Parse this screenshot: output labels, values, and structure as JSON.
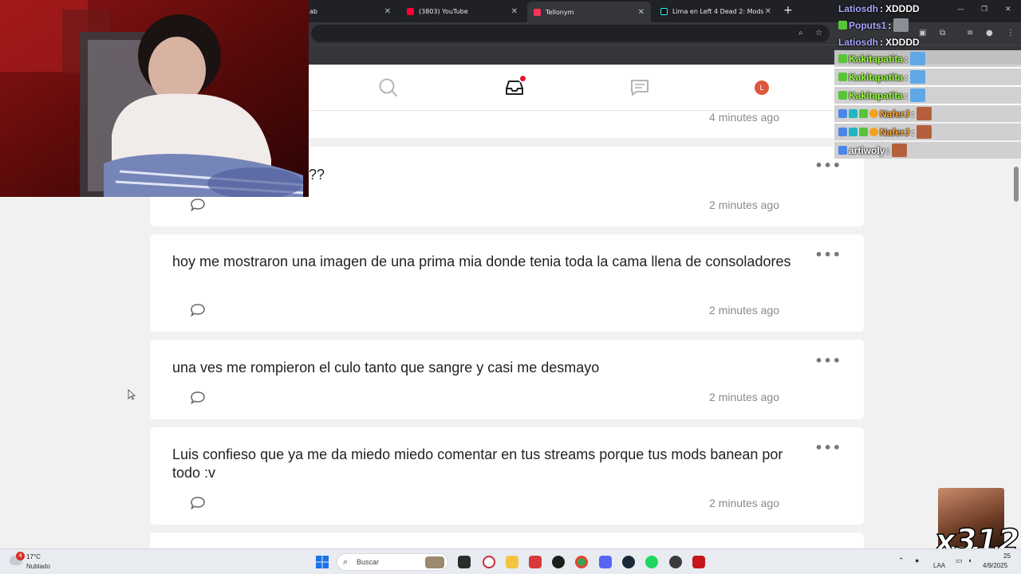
{
  "browser": {
    "tabs": [
      {
        "title": "ab",
        "icon": "tab-favicon"
      },
      {
        "title": "(3803) YouTube",
        "icon": "youtube-icon",
        "color": "#ff0033"
      },
      {
        "title": "Tellonym",
        "icon": "tellonym-icon",
        "color": "#f6335a"
      },
      {
        "title": "Lima en Left 4 Dead 2: Mods y",
        "icon": "tiktok-icon"
      }
    ],
    "new_tab": "+"
  },
  "app": {
    "accent": "#e0182e",
    "avatar_initial": "L",
    "nav": [
      "search-icon",
      "inbox-icon",
      "chat-icon",
      "profile-avatar"
    ]
  },
  "feed": {
    "partial_top_time": "4 minutes ago",
    "cards": [
      {
        "text": "??",
        "time": "2 minutes ago"
      },
      {
        "text": "hoy me mostraron una imagen de una prima mia donde tenia toda la cama llena de consoladores",
        "time": "2 minutes ago"
      },
      {
        "text": "una ves me rompieron el culo tanto que sangre y casi me desmayo",
        "time": "2 minutes ago"
      },
      {
        "text": "Luis confieso que ya me da miedo miedo comentar en tus streams porque tus mods banean por todo :v",
        "time": "2 minutes ago"
      }
    ],
    "more_label": "•••"
  },
  "chat": {
    "messages": [
      {
        "user": "Latiosdh",
        "message": "XDDDD",
        "user_color": "#a6a6ff",
        "bg": false
      },
      {
        "user": "Poputs1",
        "message": "",
        "user_color": "#a6a6ff",
        "bg": false
      },
      {
        "user": "Latiosdh",
        "message": "XDDDD",
        "user_color": "#a6a6ff",
        "bg": false
      },
      {
        "user": "Kakitapatita",
        "message": "",
        "user_color": "#9bff3e",
        "bg": true
      },
      {
        "user": "Kakitapatita",
        "message": "",
        "user_color": "#9bff3e",
        "bg": true
      },
      {
        "user": "Kakitapatita",
        "message": "",
        "user_color": "#9bff3e",
        "bg": true
      },
      {
        "user": "NaferJ",
        "message": "",
        "user_color": "#ffa52e",
        "bg": true
      },
      {
        "user": "NaferJ",
        "message": "",
        "user_color": "#ffa52e",
        "bg": true
      },
      {
        "user": "artiwoly",
        "message": "",
        "user_color": "#ffffff",
        "bg": true
      }
    ],
    "separator": ":",
    "emote_counter": "x312"
  },
  "taskbar": {
    "temperature": "17°C",
    "condition": "Nublado",
    "weather_badge": "4",
    "search_placeholder": "Buscar",
    "date": "4/9/2025",
    "time": "25",
    "lang": "LAA"
  }
}
